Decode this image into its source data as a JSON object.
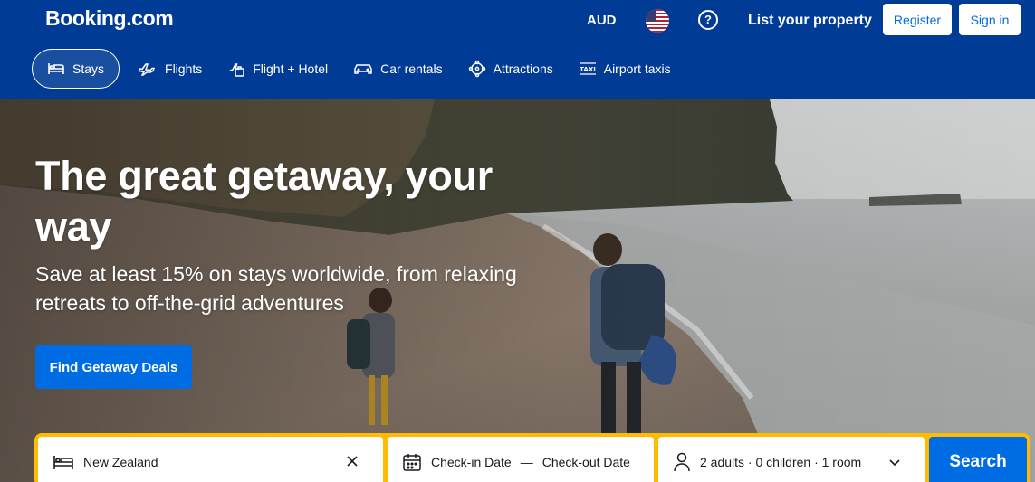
{
  "header": {
    "logo": "Booking.com",
    "currency": "AUD",
    "flag_icon": "us-flag-icon",
    "help_icon": "help-icon",
    "help_symbol": "?",
    "list_property": "List your property",
    "register": "Register",
    "sign_in": "Sign in"
  },
  "nav": {
    "items": [
      {
        "label": "Stays",
        "icon": "bed-icon",
        "active": true
      },
      {
        "label": "Flights",
        "icon": "plane-icon",
        "active": false
      },
      {
        "label": "Flight + Hotel",
        "icon": "plane-hotel-icon",
        "active": false
      },
      {
        "label": "Car rentals",
        "icon": "car-icon",
        "active": false
      },
      {
        "label": "Attractions",
        "icon": "attractions-icon",
        "active": false
      },
      {
        "label": "Airport taxis",
        "icon": "taxi-icon",
        "active": false
      }
    ]
  },
  "hero": {
    "title": "The great getaway, your way",
    "subtitle": "Save at least 15% on stays worldwide, from relaxing retreats to off-the-grid adventures",
    "cta": "Find Getaway Deals"
  },
  "search": {
    "destination_value": "New Zealand",
    "checkin": "Check-in Date",
    "dash": "—",
    "checkout": "Check-out Date",
    "guests": "2 adults · 0 children · 1 room",
    "button": "Search"
  },
  "colors": {
    "brand": "#003b95",
    "accent": "#006ce4",
    "search_border": "#febb02"
  }
}
